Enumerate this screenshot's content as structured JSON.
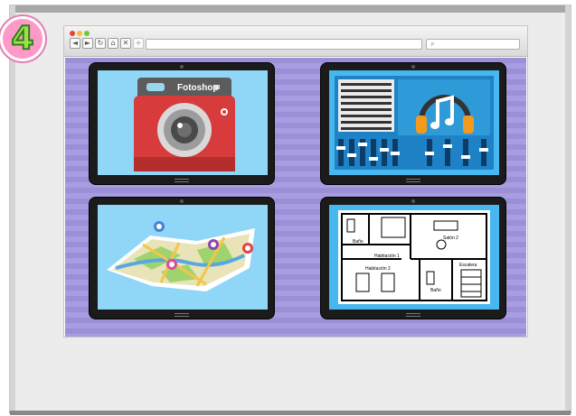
{
  "step": {
    "number": "4"
  },
  "browser": {
    "nav_back": "◄",
    "nav_forward": "►",
    "nav_reload": "↻",
    "nav_home": "⌂",
    "nav_stop": "✕",
    "new_tab": "+",
    "search_icon": "⌕"
  },
  "apps": {
    "camera": {
      "brand": "Fotoshop"
    },
    "floorplan": {
      "rooms": [
        "Baño",
        "Habitación 1",
        "Salón 2",
        "Habitación 2",
        "Baño",
        "Escalera"
      ]
    }
  },
  "colors": {
    "badge": "#ff9ac8",
    "page_bg": "#9b90d8",
    "camera_screen": "#8fd6f7",
    "music_screen": "#1f82c6",
    "map_screen": "#8fd6f7",
    "plan_screen": "#46b7ef"
  }
}
